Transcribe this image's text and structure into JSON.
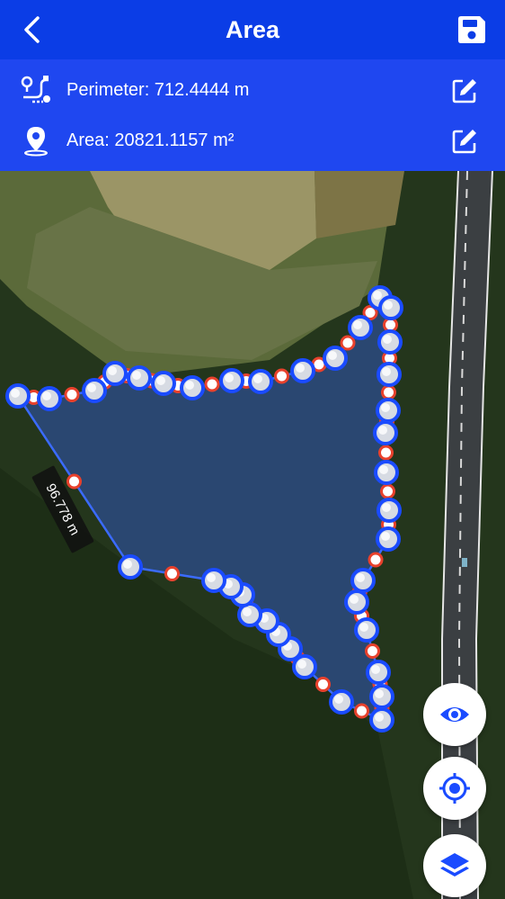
{
  "header": {
    "title": "Area",
    "back_icon": "chevron-left-icon",
    "save_icon": "save-icon"
  },
  "info": {
    "perimeter_text": "Perimeter: 712.4444 m",
    "area_text": "Area: 20821.1157 m²",
    "perimeter_icon": "route-icon",
    "area_icon": "location-pin-icon",
    "edit_icon": "edit-icon"
  },
  "map": {
    "segment_label": "96.778 m",
    "polygon_fill": "#2f56b8",
    "line_color": "#3b6bff",
    "vertex_color": "#1a4bff",
    "midpoint_color": "#e8412c"
  },
  "controls": {
    "visibility_icon": "eye-icon",
    "locate_icon": "crosshair-icon",
    "layers_icon": "layers-icon"
  },
  "colors": {
    "header": "#0b3de6",
    "info_bar": "#1f47f0"
  }
}
